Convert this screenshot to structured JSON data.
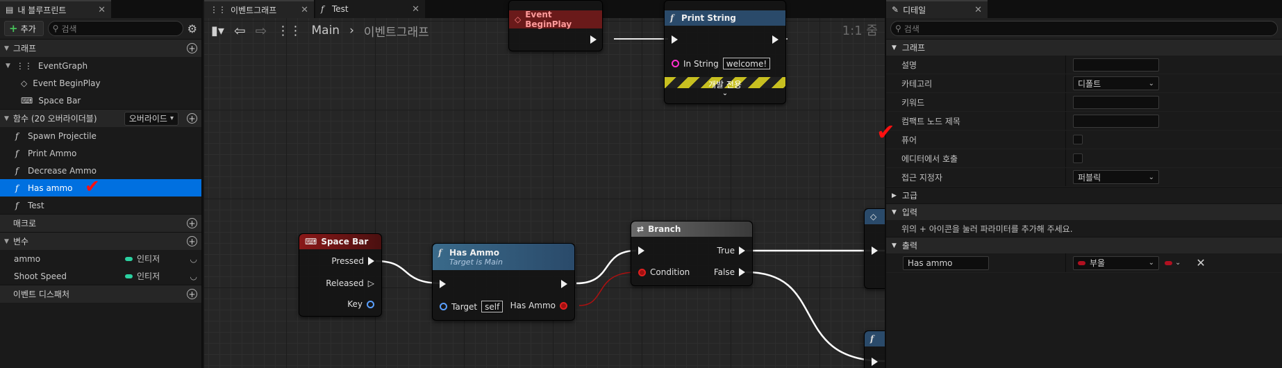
{
  "left_panel": {
    "tab_title": "내 블루프린트",
    "add_label": "추가",
    "search_placeholder": "검색",
    "sections": {
      "graphs": "그래프",
      "functions": "함수 (20 오버라이더블)",
      "override_label": "오버라이드",
      "macros": "매크로",
      "variables": "변수",
      "event_dispatchers": "이벤트 디스패처"
    },
    "graph_items": {
      "event_graph": "EventGraph",
      "begin_play": "Event BeginPlay",
      "space_bar": "Space Bar"
    },
    "functions": [
      "Spawn Projectile",
      "Print Ammo",
      "Decrease Ammo",
      "Has ammo",
      "Test"
    ],
    "selected_function": "Has ammo",
    "variables": [
      {
        "name": "ammo",
        "type": "인티저"
      },
      {
        "name": "Shoot Speed",
        "type": "인티저"
      }
    ]
  },
  "graph": {
    "tabs": [
      "이벤트그래프",
      "Test"
    ],
    "breadcrumb_root": "Main",
    "breadcrumb_current": "이벤트그래프",
    "zoom": "1:1 줌",
    "nodes": {
      "begin_play_title": "Event BeginPlay",
      "print_string_title": "Print String",
      "print_in_label": "In String",
      "print_in_value": "welcome!",
      "print_dev_only": "개발 전용",
      "space_bar_title": "Space Bar",
      "space_pressed": "Pressed",
      "space_released": "Released",
      "space_key": "Key",
      "has_ammo_title": "Has Ammo",
      "has_ammo_sub": "Target is Main",
      "has_ammo_target": "Target",
      "has_ammo_target_value": "self",
      "has_ammo_out": "Has Ammo",
      "branch_title": "Branch",
      "branch_condition": "Condition",
      "branch_true": "True",
      "branch_false": "False"
    }
  },
  "details": {
    "tab_title": "디테일",
    "search_placeholder": "검색",
    "graph_section": "그래프",
    "rows": {
      "description": "설명",
      "category": "카테고리",
      "category_value": "디폴트",
      "keywords": "키워드",
      "compact_title": "컴팩트 노드 제목",
      "pure": "퓨어",
      "call_in_editor": "에디터에서 호출",
      "access_specifier": "접근 지정자",
      "access_value": "퍼블릭"
    },
    "advanced_section": "고급",
    "inputs_section": "입력",
    "inputs_hint": "위의 + 아이콘을 눌러 파라미터를 추가해 주세요.",
    "outputs_section": "출력",
    "output_name": "Has ammo",
    "output_type": "부울"
  },
  "colors": {
    "selection": "#0070e0",
    "check_mark": "#ff1010",
    "integer_pin": "#2bd0a0",
    "bool_pin": "#b01020",
    "space_bar_header": "#8a1818",
    "function_header": "#3a6a8a",
    "branch_header": "#5a5a5a"
  }
}
